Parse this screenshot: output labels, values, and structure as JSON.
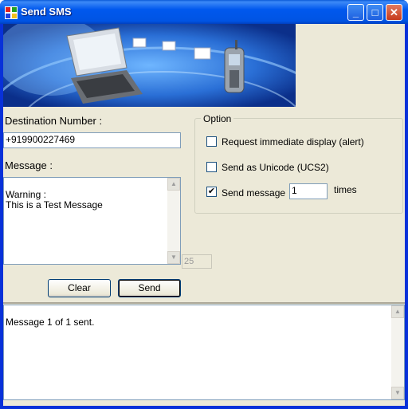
{
  "window": {
    "title": "Send SMS",
    "title_icon": "app-icon"
  },
  "titlebar_buttons": {
    "minimize": "_",
    "maximize": "□",
    "close": "✕"
  },
  "form": {
    "destination_label": "Destination Number :",
    "destination_value": "+919900227469",
    "message_label": "Message :",
    "message_text": "Warning :\nThis is a Test Message",
    "char_count": "25"
  },
  "options": {
    "group_title": "Option",
    "alert_label": "Request immediate display (alert)",
    "alert_checked": false,
    "unicode_label": "Send as Unicode (UCS2)",
    "unicode_checked": false,
    "repeat_label": "Send message",
    "repeat_checked": true,
    "repeat_count": "1",
    "repeat_suffix": "times"
  },
  "buttons": {
    "clear": "Clear",
    "send": "Send"
  },
  "log": {
    "text": "Message 1 of 1 sent."
  }
}
